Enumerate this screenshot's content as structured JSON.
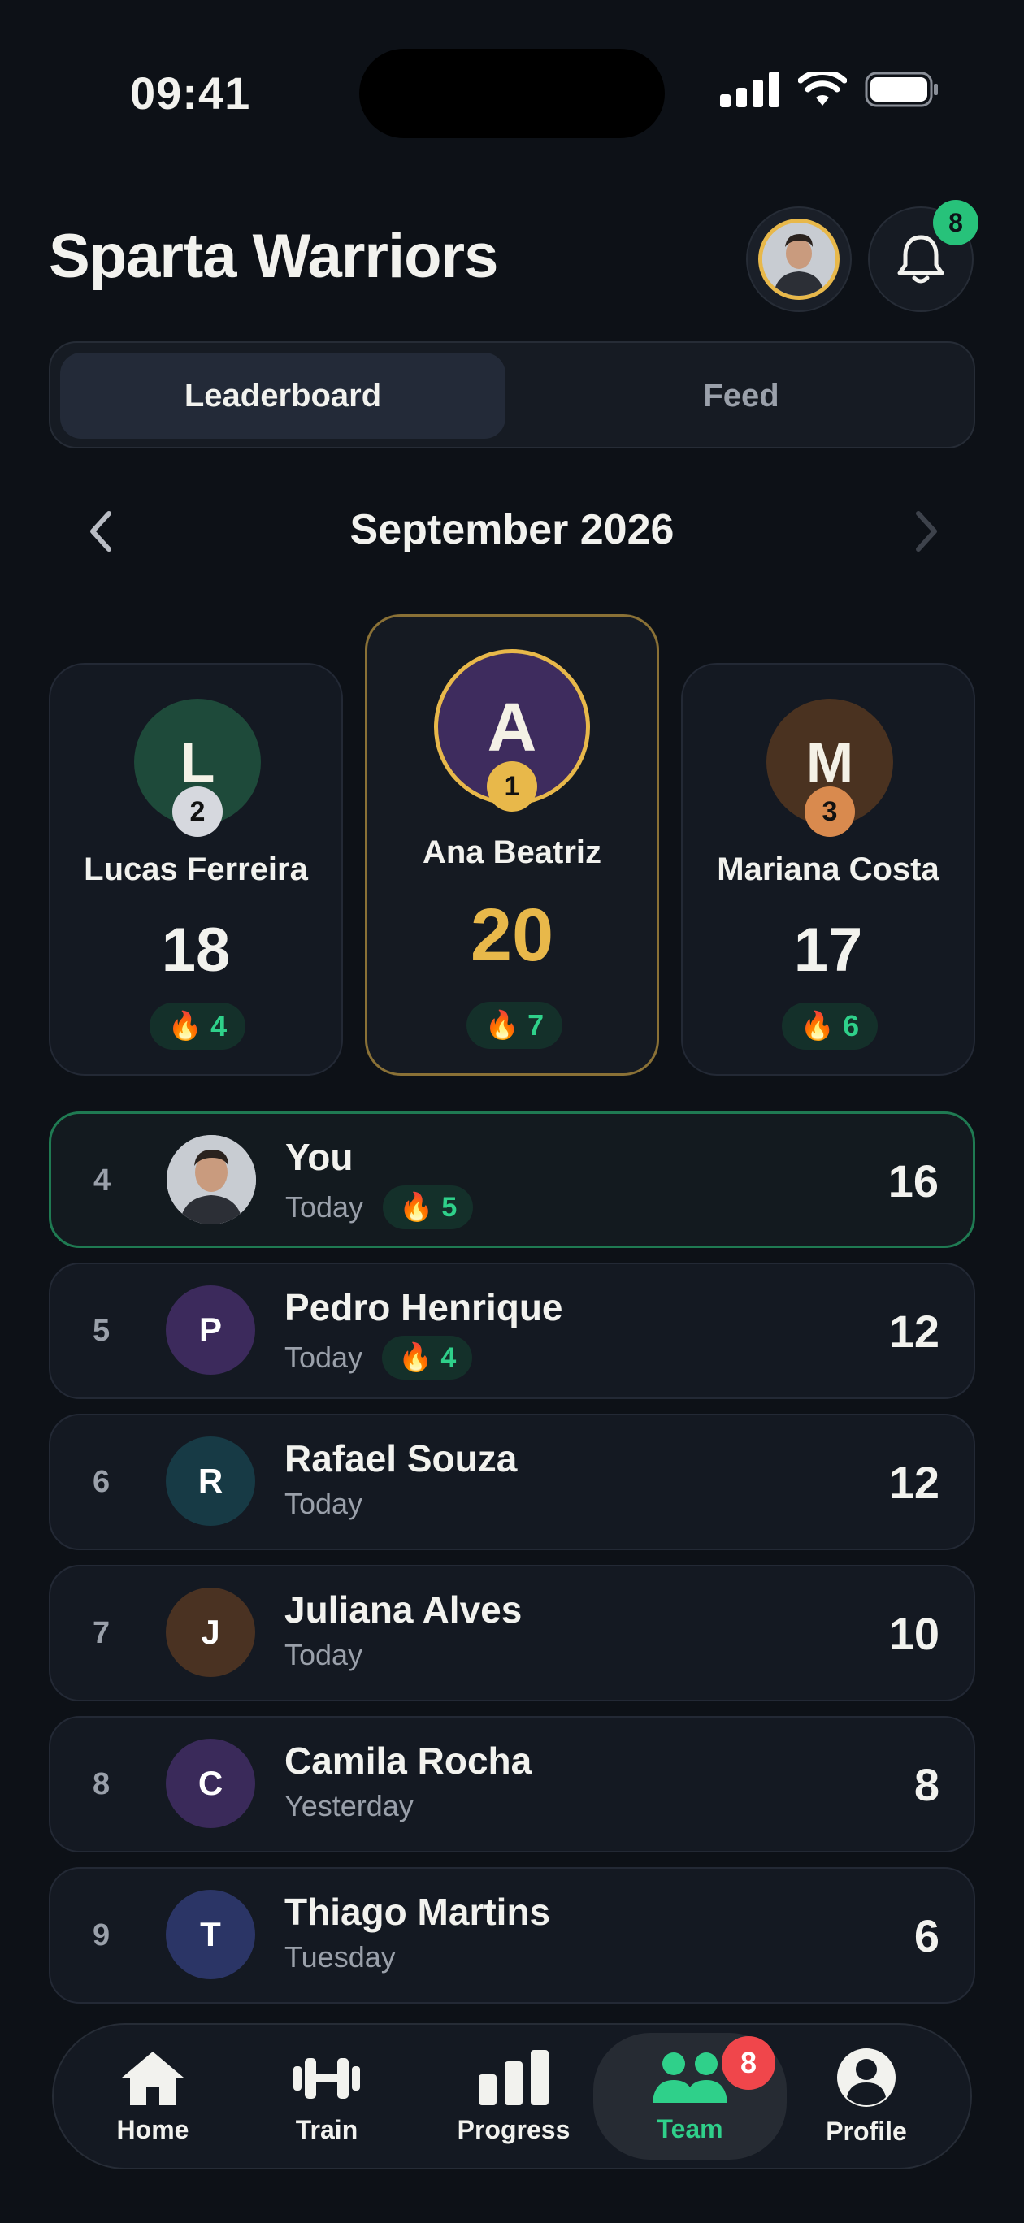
{
  "status_bar": {
    "time": "09:41"
  },
  "header": {
    "title": "Sparta Warriors",
    "notifications_count": "8"
  },
  "tabs": [
    {
      "label": "Leaderboard",
      "active": true
    },
    {
      "label": "Feed",
      "active": false
    }
  ],
  "month": {
    "label": "September 2026"
  },
  "podium": [
    {
      "rank": "2",
      "initial": "L",
      "name": "Lucas Ferreira",
      "score": "18",
      "streak": "4",
      "color": "#1e4a3a"
    },
    {
      "rank": "1",
      "initial": "A",
      "name": "Ana Beatriz",
      "score": "20",
      "streak": "7",
      "color": "#3e2c5e"
    },
    {
      "rank": "3",
      "initial": "M",
      "name": "Mariana Costa",
      "score": "17",
      "streak": "6",
      "color": "#4a3220"
    }
  ],
  "leaderboard": [
    {
      "rank": "4",
      "name": "You",
      "when": "Today",
      "streak": "5",
      "score": "16",
      "is_me": true
    },
    {
      "rank": "5",
      "initial": "P",
      "name": "Pedro Henrique",
      "when": "Today",
      "streak": "4",
      "score": "12",
      "color": "#3c2a5c"
    },
    {
      "rank": "6",
      "initial": "R",
      "name": "Rafael Souza",
      "when": "Today",
      "score": "12",
      "color": "#173a45"
    },
    {
      "rank": "7",
      "initial": "J",
      "name": "Juliana Alves",
      "when": "Today",
      "score": "10",
      "color": "#4a3222"
    },
    {
      "rank": "8",
      "initial": "C",
      "name": "Camila Rocha",
      "when": "Yesterday",
      "score": "8",
      "color": "#3a2a5a"
    },
    {
      "rank": "9",
      "initial": "T",
      "name": "Thiago Martins",
      "when": "Tuesday",
      "score": "6",
      "color": "#2b3566"
    }
  ],
  "nav": {
    "items": [
      {
        "label": "Home",
        "icon": "home-icon"
      },
      {
        "label": "Train",
        "icon": "dumbbell-icon"
      },
      {
        "label": "Progress",
        "icon": "bar-chart-icon"
      },
      {
        "label": "Team",
        "icon": "team-icon",
        "active": true,
        "badge": "8"
      },
      {
        "label": "Profile",
        "icon": "profile-icon"
      }
    ]
  },
  "colors": {
    "accent_green": "#2fd08a",
    "gold": "#e8b84a",
    "silver": "#d6d8de",
    "bronze": "#d98a4e",
    "badge_red": "#f0464b"
  }
}
